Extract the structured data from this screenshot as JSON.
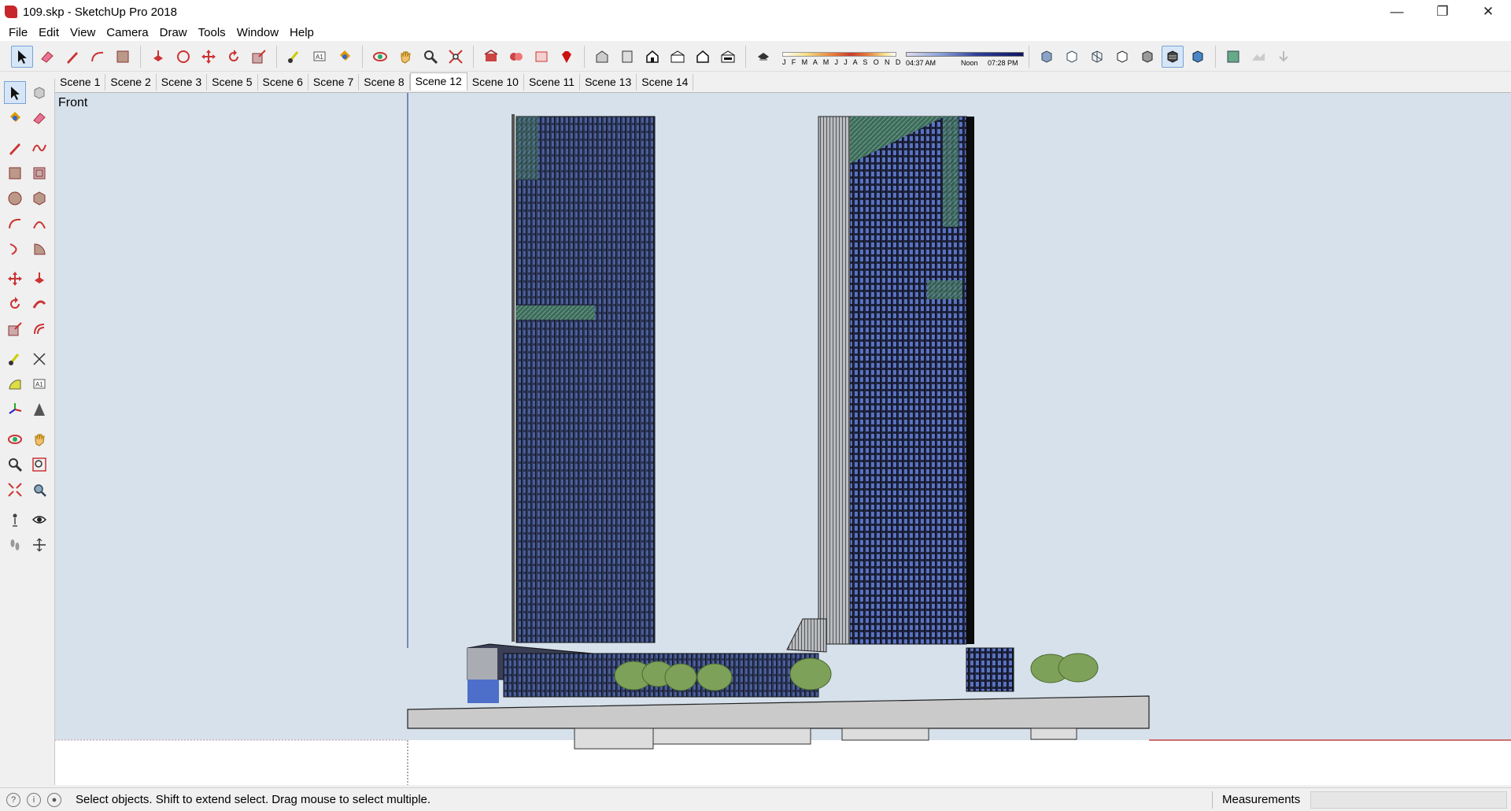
{
  "window": {
    "title": "109.skp - SketchUp Pro 2018"
  },
  "menu": [
    "File",
    "Edit",
    "View",
    "Camera",
    "Draw",
    "Tools",
    "Window",
    "Help"
  ],
  "sun": {
    "months": "J F M A M J J A S O N D",
    "time_start": "04:37 AM",
    "time_mid": "Noon",
    "time_end": "07:28 PM"
  },
  "scenes": [
    "Scene 1",
    "Scene 2",
    "Scene 3",
    "Scene 5",
    "Scene 6",
    "Scene 7",
    "Scene 8",
    "Scene 12",
    "Scene 10",
    "Scene 11",
    "Scene 13",
    "Scene 14"
  ],
  "active_scene": "Scene 12",
  "viewport": {
    "view_name": "Front"
  },
  "status": {
    "message": "Select objects. Shift to extend select. Drag mouse to select multiple.",
    "measurements_label": "Measurements",
    "measurements_value": ""
  },
  "colors": {
    "accent": "#7aa2d6",
    "sky": "#d6e1eb",
    "glass": "#3b4a7a",
    "trees": "#7ea15a"
  }
}
